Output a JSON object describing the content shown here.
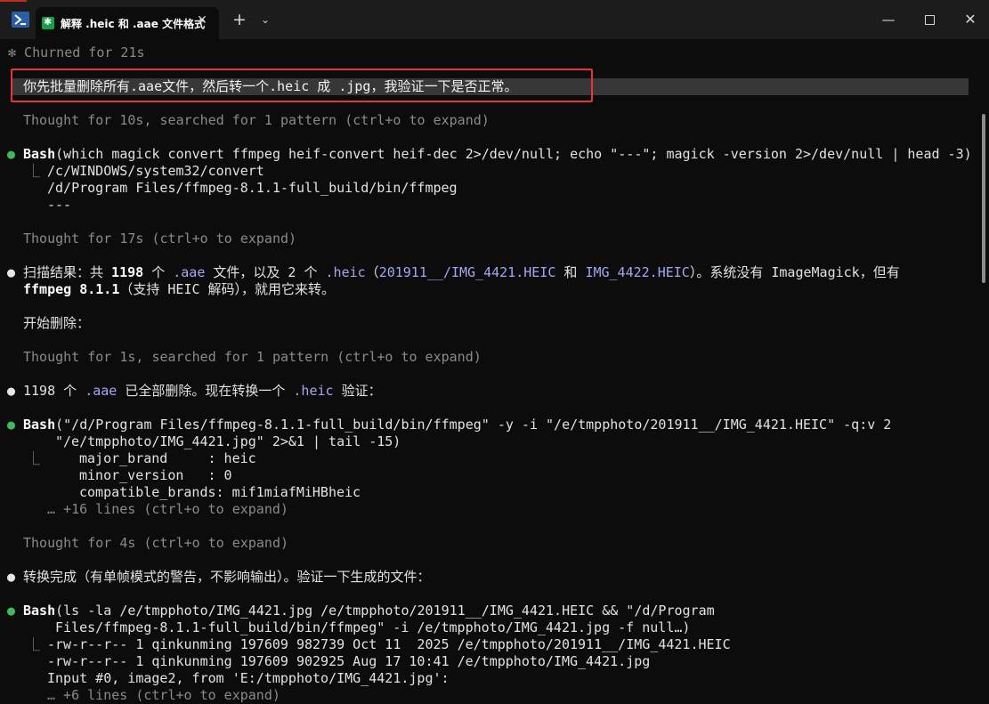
{
  "window": {
    "tab_title": "解释 .heic 和 .aae 文件格式",
    "tab_close": "✕",
    "new_tab": "+",
    "dropdown": "⌄",
    "minimize": "—",
    "close": "✕"
  },
  "lines": {
    "churned": "✻ Churned for 21s",
    "prompt": "你先批量删除所有.aae文件，然后转一个.heic 成 .jpg，我验证一下是否正常。",
    "thought1": "Thought for 10s, searched for 1 pattern (ctrl+o to expand)",
    "bash1_name": "Bash",
    "bash1_args": "(which magick convert ffmpeg heif-convert heif-dec 2>/dev/null; echo \"---\"; magick -version 2>/dev/null | head -3)",
    "bash1_out1": "/c/WINDOWS/system32/convert",
    "bash1_out2": "/d/Program Files/ffmpeg-8.1.1-full_build/bin/ffmpeg",
    "bash1_out3": "---",
    "thought2": "Thought for 17s (ctrl+o to expand)",
    "scan_p1": "扫描结果：共 ",
    "scan_count": "1198",
    "scan_p2": " 个 ",
    "scan_aae": ".aae",
    "scan_p3": " 文件，以及 2 个 ",
    "scan_heic": ".heic",
    "scan_p4": "（",
    "scan_file1": "201911__/IMG_4421.HEIC",
    "scan_p5": " 和 ",
    "scan_file2": "IMG_4422.HEIC",
    "scan_p6": "）。系统没有 ImageMagick，但有",
    "scan2_ffmpeg": "ffmpeg 8.1.1",
    "scan2_rest": "（支持 HEIC 解码），就用它来转。",
    "start_delete": "开始删除：",
    "thought3": "Thought for 1s, searched for 1 pattern (ctrl+o to expand)",
    "deleted_count": "1198",
    "deleted_p1": " 个 ",
    "deleted_aae": ".aae",
    "deleted_p2": " 已全部删除。现在转换一个 ",
    "deleted_heic": ".heic",
    "deleted_p3": " 验证：",
    "bash2_name": "Bash",
    "bash2_args1": "(\"/d/Program Files/ffmpeg-8.1.1-full_build/bin/ffmpeg\" -y -i \"/e/tmpphoto/201911__/IMG_4421.HEIC\" -q:v 2",
    "bash2_args2": "\"/e/tmpphoto/IMG_4421.jpg\" 2>&1 | tail -15)",
    "bash2_out1": "major_brand     : heic",
    "bash2_out2": "minor_version   : 0",
    "bash2_out3": "compatible_brands: mif1miafMiHBheic",
    "bash2_more": "… +16 lines (ctrl+o to expand)",
    "thought4": "Thought for 4s (ctrl+o to expand)",
    "convert_done": "转换完成（有单帧模式的警告，不影响输出）。验证一下生成的文件：",
    "bash3_name": "Bash",
    "bash3_args1": "(ls -la /e/tmpphoto/IMG_4421.jpg /e/tmpphoto/201911__/IMG_4421.HEIC && \"/d/Program",
    "bash3_args2": "Files/ffmpeg-8.1.1-full_build/bin/ffmpeg\" -i /e/tmpphoto/IMG_4421.jpg -f null…)",
    "bash3_out1": "-rw-r--r-- 1 qinkunming 197609 982739 Oct 11  2025 /e/tmpphoto/201911__/IMG_4421.HEIC",
    "bash3_out2": "-rw-r--r-- 1 qinkunming 197609 902925 Aug 17 10:41 /e/tmpphoto/IMG_4421.jpg",
    "bash3_out3": "Input #0, image2, from 'E:/tmpphoto/IMG_4421.jpg':",
    "bash3_more": "… +6 lines (ctrl+o to expand)"
  },
  "glyphs": {
    "dot": "●",
    "elbow": "⎿"
  },
  "colors": {
    "highlight_border": "#e3353a",
    "success_dot": "#3fbb5c",
    "path_accent": "#a3a6f5"
  }
}
